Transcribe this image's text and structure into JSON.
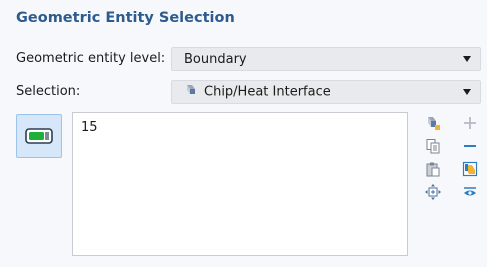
{
  "section": {
    "title": "Geometric Entity Selection"
  },
  "entity_level": {
    "label": "Geometric entity level:",
    "value": "Boundary"
  },
  "selection": {
    "label": "Selection:",
    "value": "Chip/Heat Interface"
  },
  "selected_entities": [
    "15"
  ],
  "icons": {
    "toggle": "active-selection-toggle-icon",
    "selection": "named-selection-icon",
    "paste": "paste-selection-icon",
    "copy": "copy-selection-icon",
    "clipboard": "clipboard-icon",
    "zoom": "zoom-to-selection-icon",
    "add": "add-icon",
    "remove": "remove-icon",
    "clear": "clear-selection-icon",
    "visibility": "show-selection-icon"
  },
  "colors": {
    "title": "#2d5b8d",
    "accent_green": "#1fae3a",
    "toolbar_blue": "#2e7cc4"
  }
}
